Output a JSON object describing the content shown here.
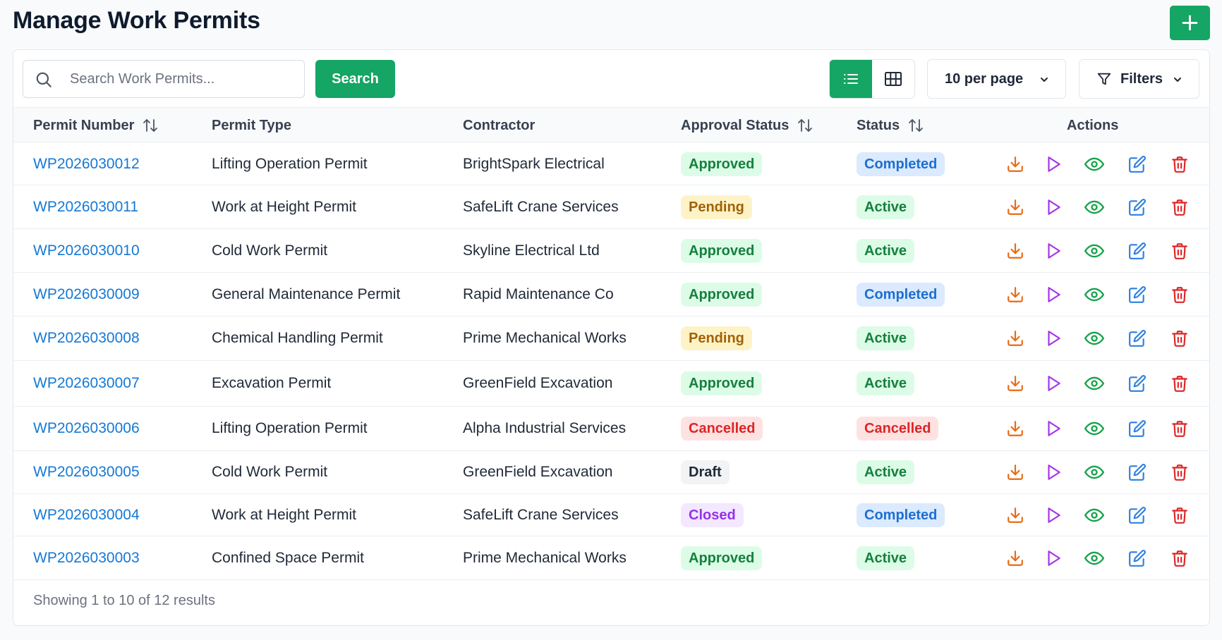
{
  "page": {
    "title": "Manage Work Permits",
    "add_button_label": "+"
  },
  "toolbar": {
    "search_placeholder": "Search Work Permits...",
    "search_value": "",
    "search_button_label": "Search",
    "view_mode": "list",
    "per_page_label": "10 per page",
    "filters_label": "Filters"
  },
  "table": {
    "columns": [
      {
        "key": "permit_number",
        "label": "Permit Number",
        "sortable": true
      },
      {
        "key": "permit_type",
        "label": "Permit Type",
        "sortable": false
      },
      {
        "key": "contractor",
        "label": "Contractor",
        "sortable": false
      },
      {
        "key": "approval_status",
        "label": "Approval Status",
        "sortable": true
      },
      {
        "key": "status",
        "label": "Status",
        "sortable": true
      },
      {
        "key": "actions",
        "label": "Actions",
        "sortable": false
      }
    ],
    "action_icons": [
      "download-icon",
      "play-icon",
      "eye-icon",
      "edit-icon",
      "trash-icon"
    ],
    "rows": [
      {
        "permit_number": "WP2026030012",
        "permit_type": "Lifting Operation Permit",
        "contractor": "BrightSpark Electrical",
        "approval_status": "Approved",
        "status": "Completed"
      },
      {
        "permit_number": "WP2026030011",
        "permit_type": "Work at Height Permit",
        "contractor": "SafeLift Crane Services",
        "approval_status": "Pending",
        "status": "Active"
      },
      {
        "permit_number": "WP2026030010",
        "permit_type": "Cold Work Permit",
        "contractor": "Skyline Electrical Ltd",
        "approval_status": "Approved",
        "status": "Active"
      },
      {
        "permit_number": "WP2026030009",
        "permit_type": "General Maintenance Permit",
        "contractor": "Rapid Maintenance Co",
        "approval_status": "Approved",
        "status": "Completed"
      },
      {
        "permit_number": "WP2026030008",
        "permit_type": "Chemical Handling Permit",
        "contractor": "Prime Mechanical Works",
        "approval_status": "Pending",
        "status": "Active"
      },
      {
        "permit_number": "WP2026030007",
        "permit_type": "Excavation Permit",
        "contractor": "GreenField Excavation",
        "approval_status": "Approved",
        "status": "Active"
      },
      {
        "permit_number": "WP2026030006",
        "permit_type": "Lifting Operation Permit",
        "contractor": "Alpha Industrial Services",
        "approval_status": "Cancelled",
        "status": "Cancelled"
      },
      {
        "permit_number": "WP2026030005",
        "permit_type": "Cold Work Permit",
        "contractor": "GreenField Excavation",
        "approval_status": "Draft",
        "status": "Active"
      },
      {
        "permit_number": "WP2026030004",
        "permit_type": "Work at Height Permit",
        "contractor": "SafeLift Crane Services",
        "approval_status": "Closed",
        "status": "Completed"
      },
      {
        "permit_number": "WP2026030003",
        "permit_type": "Confined Space Permit",
        "contractor": "Prime Mechanical Works",
        "approval_status": "Approved",
        "status": "Active"
      }
    ]
  },
  "badge_colors": {
    "Approved": {
      "bg": "#dcfce7",
      "fg": "#15803d"
    },
    "Pending": {
      "bg": "#fef3c7",
      "fg": "#a16207"
    },
    "Cancelled": {
      "bg": "#fee2e2",
      "fg": "#dc2626"
    },
    "Draft": {
      "bg": "#f1f3f5",
      "fg": "#1f2937"
    },
    "Closed": {
      "bg": "#f3e8ff",
      "fg": "#9333ea"
    },
    "Completed": {
      "bg": "#dbeafe",
      "fg": "#1d6fd1"
    },
    "Active": {
      "bg": "#dcfce7",
      "fg": "#15803d"
    }
  },
  "action_colors": {
    "download": "#ea6a12",
    "play": "#a333e8",
    "view": "#16a34a",
    "edit": "#2f7fe0",
    "delete": "#dc2626"
  },
  "accent_color": "#15a564",
  "footer": {
    "summary": "Showing 1 to 10 of 12 results"
  }
}
